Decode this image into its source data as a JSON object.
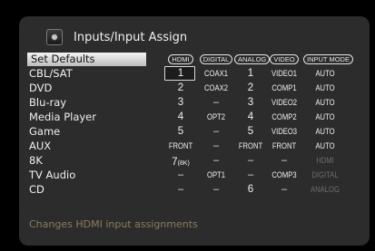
{
  "header": {
    "title": "Inputs/Input Assign"
  },
  "columns": {
    "hdmi": "HDMI",
    "digital": "DIGITAL",
    "analog": "ANALOG",
    "video": "VIDEO",
    "input_mode": "INPUT MODE"
  },
  "set_defaults": "Set Defaults",
  "rows": [
    {
      "label": "CBL/SAT",
      "hdmi": "1",
      "digital": "COAX1",
      "analog": "1",
      "video": "VIDEO1",
      "mode": "AUTO"
    },
    {
      "label": "DVD",
      "hdmi": "2",
      "digital": "COAX2",
      "analog": "2",
      "video": "COMP1",
      "mode": "AUTO"
    },
    {
      "label": "Blu-ray",
      "hdmi": "3",
      "digital": "–",
      "analog": "3",
      "video": "VIDEO2",
      "mode": "AUTO"
    },
    {
      "label": "Media Player",
      "hdmi": "4",
      "digital": "OPT2",
      "analog": "4",
      "video": "COMP2",
      "mode": "AUTO"
    },
    {
      "label": "Game",
      "hdmi": "5",
      "digital": "–",
      "analog": "5",
      "video": "VIDEO3",
      "mode": "AUTO"
    },
    {
      "label": "AUX",
      "hdmi": "FRONT",
      "digital": "–",
      "analog": "FRONT",
      "video": "FRONT",
      "mode": "AUTO"
    },
    {
      "label": "8K",
      "hdmi": "7",
      "hdmi_sub": "(8K)",
      "digital": "–",
      "analog": "–",
      "video": "–",
      "mode": "HDMI"
    },
    {
      "label": "TV Audio",
      "hdmi": "–",
      "digital": "OPT1",
      "analog": "–",
      "video": "COMP3",
      "mode": "DIGITAL"
    },
    {
      "label": "CD",
      "hdmi": "–",
      "digital": "–",
      "analog": "6",
      "video": "–",
      "mode": "ANALOG"
    }
  ],
  "footer": {
    "hint": "Changes HDMI input assignments"
  },
  "colors": {
    "panel": "#2c2c2c",
    "hint_text": "#8a7e5a",
    "dim_text": "#6d6d6d"
  },
  "icons": {
    "header": "input-assign-icon"
  }
}
